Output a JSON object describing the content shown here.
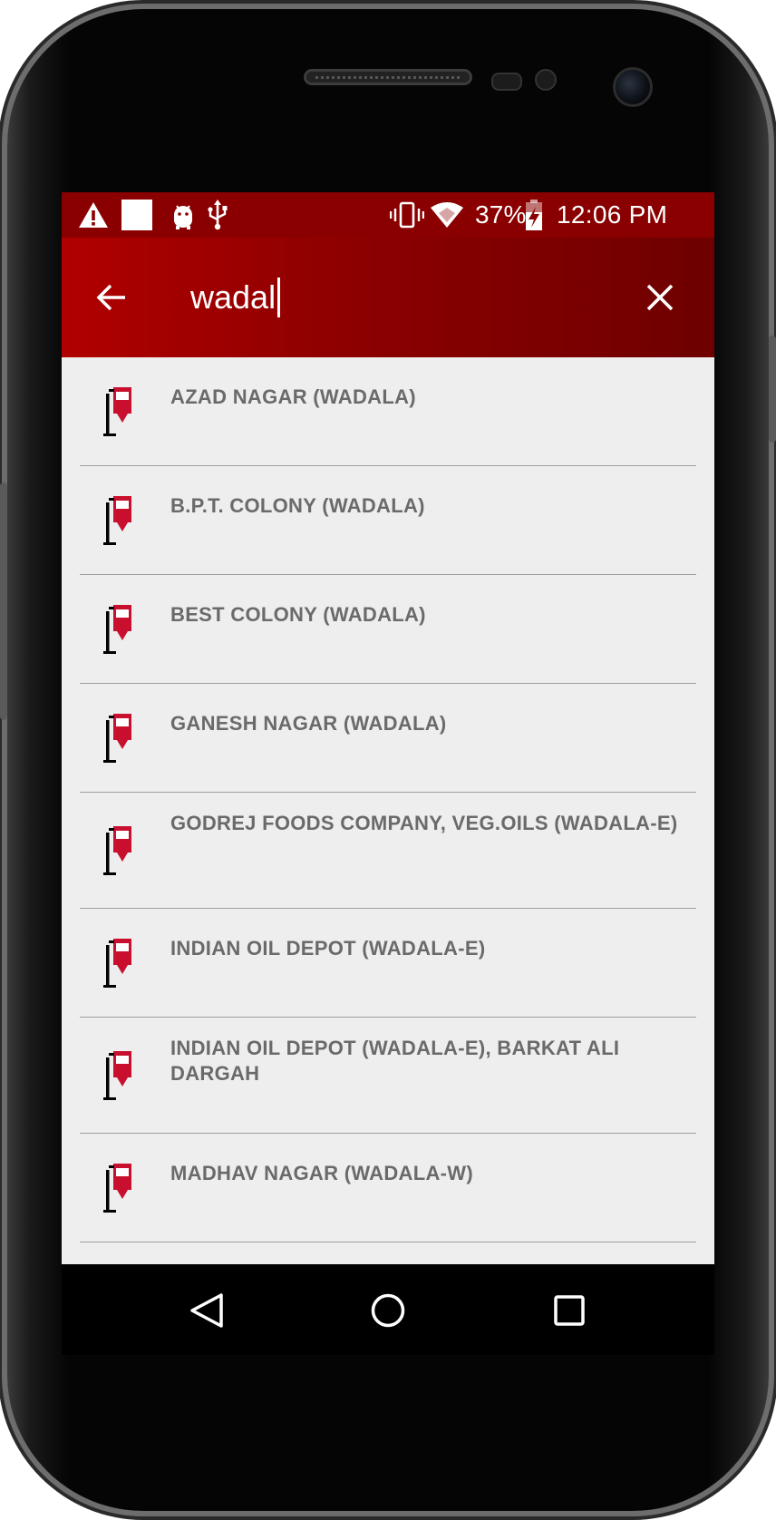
{
  "status_bar": {
    "battery_percent": "37%",
    "time": "12:06 PM",
    "left_icons": [
      "warning-icon",
      "blank-notification-icon",
      "android-debug-icon",
      "usb-icon"
    ],
    "right_icons": [
      "vibrate-icon",
      "wifi-icon",
      "battery-charging-icon"
    ]
  },
  "toolbar": {
    "search_value": "wadal",
    "back_icon": "arrow-left-icon",
    "clear_icon": "close-icon"
  },
  "results": [
    {
      "label": "AZAD NAGAR (WADALA)",
      "icon": "bus-stop-icon"
    },
    {
      "label": "B.P.T. COLONY (WADALA)",
      "icon": "bus-stop-icon"
    },
    {
      "label": "BEST COLONY (WADALA)",
      "icon": "bus-stop-icon"
    },
    {
      "label": "GANESH NAGAR (WADALA)",
      "icon": "bus-stop-icon"
    },
    {
      "label": "GODREJ FOODS COMPANY, VEG.OILS (WADALA-E)",
      "icon": "bus-stop-icon"
    },
    {
      "label": "INDIAN OIL DEPOT (WADALA-E)",
      "icon": "bus-stop-icon"
    },
    {
      "label": "INDIAN OIL DEPOT (WADALA-E), BARKAT ALI DARGAH",
      "icon": "bus-stop-icon"
    },
    {
      "label": "MADHAV NAGAR (WADALA-W)",
      "icon": "bus-stop-icon"
    }
  ],
  "nav_bar": [
    "back-triangle-icon",
    "home-circle-icon",
    "recents-square-icon"
  ],
  "colors": {
    "status_bar": "#8a0000",
    "toolbar_start": "#b00000",
    "toolbar_end": "#6e0000",
    "list_background": "#eeeeee",
    "item_text": "#6a6a6a",
    "icon_accent": "#c8102e"
  }
}
